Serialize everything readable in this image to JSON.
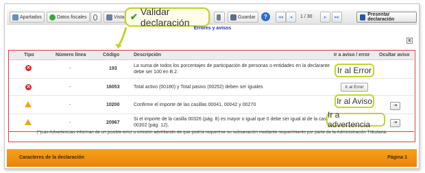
{
  "toolbar": {
    "apartados": "Apartados",
    "datos_fiscales": "Datos fiscales",
    "vista": "Vista",
    "guardar": "Guardar",
    "help": "?",
    "nav_first": "◂◂",
    "nav_prev": "◂",
    "page_info": "1 / 30",
    "nav_next": "▸",
    "nav_last": "▸▸",
    "presentar": "Presentar declaración"
  },
  "callout_validar": "Validar declaración",
  "errors": {
    "title": "Errores y avisos",
    "close": "x",
    "headers": [
      "Tipo",
      "Número línea",
      "Código",
      "Descripción",
      "Ir a aviso / error",
      "Ocultar aviso"
    ],
    "rows": [
      {
        "type": "error",
        "line": "-",
        "code": "193",
        "desc1": "La suma de todos los porcentajes de participación de personas o entidades en la declarante",
        "desc2": "debe ser 100 en B.2.",
        "action": "Ir al Error",
        "hide": ""
      },
      {
        "type": "error",
        "line": "-",
        "code": "16053",
        "desc1": "Total activo (00180) y Total pasivo (00252) deben ser iguales",
        "desc2": "",
        "action": "Ir al Error",
        "hide": ""
      },
      {
        "type": "warning",
        "line": "-",
        "code": "10200",
        "desc1": "Confirme el importe de las casillas 00041, 00042 y 00270",
        "desc2": "",
        "action": "Ir al Aviso",
        "hide": "⇥"
      },
      {
        "type": "warning",
        "line": "-",
        "code": "20967",
        "desc1": "Si el importe de la casilla 00326 (pág. 8) es mayor o igual que 0 debe ser igual al de la casilla",
        "desc2": "00302 (pág. 12).",
        "action": "Ir a advertencia",
        "hide": "⇥"
      }
    ],
    "note": "(*)Las Advertencias informan de un posible error u omisión advirtiendo de que podría requerirse su subsanación mediante requerimiento por parte de la Administración Tributaria."
  },
  "callouts": {
    "ir_al_error": "Ir al Error",
    "ir_al_aviso": "Ir al Aviso",
    "ir_a_advertencia": "Ir a advertencia"
  },
  "footer": {
    "left": "Caracteres de la declaración",
    "right": "Página 1"
  },
  "colors": {
    "footer": "#f39a14",
    "callout_border": "#c3d427",
    "error": "#d22222",
    "warning": "#f0a410",
    "table_border": "#e23a3a",
    "title": "#2233aa"
  }
}
